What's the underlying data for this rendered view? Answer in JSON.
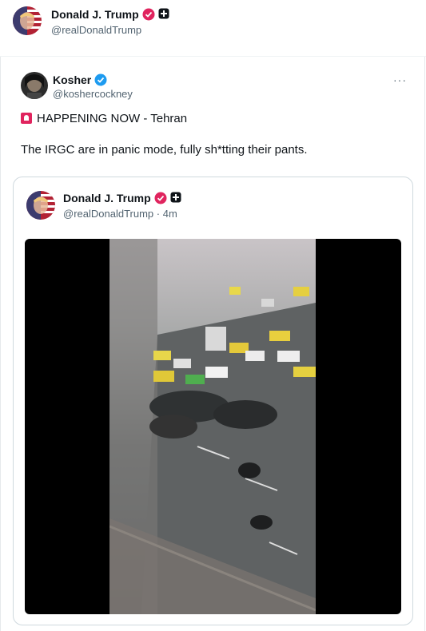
{
  "top_tweet": {
    "name": "Donald J. Trump",
    "handle": "@realDonaldTrump",
    "avatar_icon": "trump-flag-avatar"
  },
  "repost": {
    "name": "Kosher",
    "handle": "@koshercockney",
    "more_label": "···",
    "line1": "HAPPENING NOW - Tehran",
    "line1_icon": "siren-emoji",
    "line2": "The IRGC are in panic mode, fully sh*tting their pants.",
    "avatar_icon": "kosher-avatar"
  },
  "quoted": {
    "name": "Donald J. Trump",
    "handle": "@realDonaldTrump",
    "separator": "·",
    "time": "4m",
    "avatar_icon": "trump-flag-avatar",
    "media_description_icon": "video-thumbnail"
  },
  "colors": {
    "verified_blue": "#1d9bf0",
    "verified_pink": "#e0245e",
    "text_secondary": "#536471",
    "border": "#cfd9de"
  }
}
